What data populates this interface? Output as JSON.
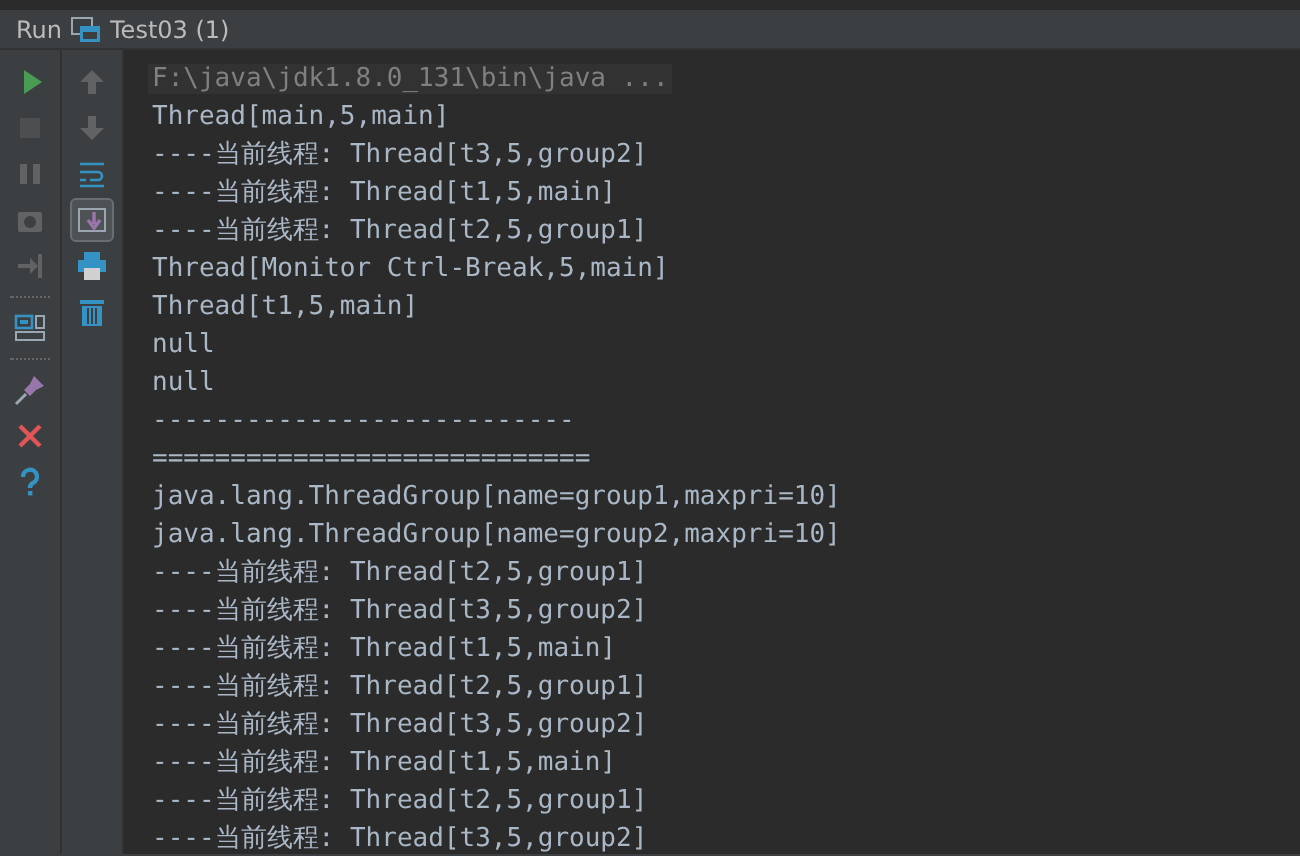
{
  "tool_window": {
    "label": "Run",
    "tab": "Test03 (1)"
  },
  "left_toolbar": [
    {
      "kind": "run",
      "disabled": false
    },
    {
      "kind": "stop",
      "disabled": true
    },
    {
      "kind": "pause",
      "disabled": true
    },
    {
      "kind": "camera",
      "disabled": true
    },
    {
      "kind": "exit",
      "disabled": true
    },
    {
      "kind": "separator"
    },
    {
      "kind": "layout",
      "disabled": false
    },
    {
      "kind": "separator"
    },
    {
      "kind": "pin",
      "disabled": false
    },
    {
      "kind": "close",
      "disabled": false
    },
    {
      "kind": "help",
      "disabled": false
    }
  ],
  "right_toolbar": [
    {
      "kind": "up",
      "disabled": true,
      "on": false
    },
    {
      "kind": "down",
      "disabled": true,
      "on": false
    },
    {
      "kind": "wrap",
      "disabled": false,
      "on": false
    },
    {
      "kind": "scroll",
      "disabled": false,
      "on": true
    },
    {
      "kind": "print",
      "disabled": false,
      "on": false
    },
    {
      "kind": "trash",
      "disabled": false,
      "on": false
    }
  ],
  "console": [
    {
      "kind": "command",
      "text": "F:\\java\\jdk1.8.0_131\\bin\\java ..."
    },
    {
      "kind": "output",
      "text": "Thread[main,5,main]"
    },
    {
      "kind": "output",
      "text": "----当前线程: Thread[t3,5,group2]"
    },
    {
      "kind": "output",
      "text": "----当前线程: Thread[t1,5,main]"
    },
    {
      "kind": "output",
      "text": "----当前线程: Thread[t2,5,group1]"
    },
    {
      "kind": "output",
      "text": "Thread[Monitor Ctrl-Break,5,main]"
    },
    {
      "kind": "output",
      "text": "Thread[t1,5,main]"
    },
    {
      "kind": "output",
      "text": "null"
    },
    {
      "kind": "output",
      "text": "null"
    },
    {
      "kind": "output",
      "text": "---------------------------"
    },
    {
      "kind": "output",
      "text": "============================"
    },
    {
      "kind": "output",
      "text": "java.lang.ThreadGroup[name=group1,maxpri=10]"
    },
    {
      "kind": "output",
      "text": "java.lang.ThreadGroup[name=group2,maxpri=10]"
    },
    {
      "kind": "output",
      "text": "----当前线程: Thread[t2,5,group1]"
    },
    {
      "kind": "output",
      "text": "----当前线程: Thread[t3,5,group2]"
    },
    {
      "kind": "output",
      "text": "----当前线程: Thread[t1,5,main]"
    },
    {
      "kind": "output",
      "text": "----当前线程: Thread[t2,5,group1]"
    },
    {
      "kind": "output",
      "text": "----当前线程: Thread[t3,5,group2]"
    },
    {
      "kind": "output",
      "text": "----当前线程: Thread[t1,5,main]"
    },
    {
      "kind": "output",
      "text": "----当前线程: Thread[t2,5,group1]"
    },
    {
      "kind": "output",
      "text": "----当前线程: Thread[t3,5,group2]"
    }
  ]
}
